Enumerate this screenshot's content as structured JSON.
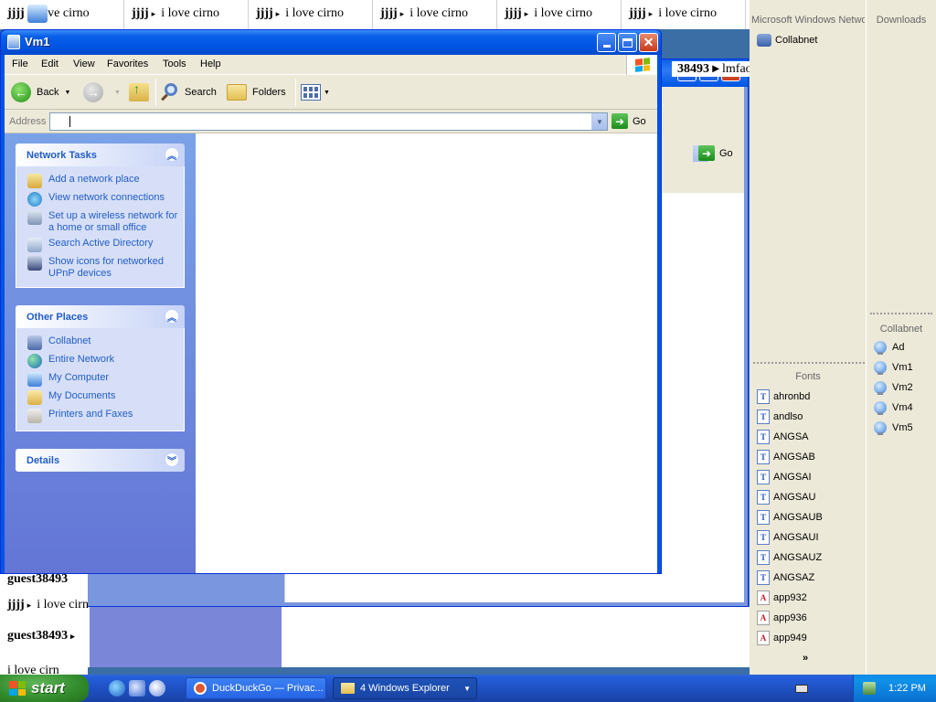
{
  "background_chat": {
    "tabs": [
      {
        "user": "jjjj",
        "text": "ve cirno"
      },
      {
        "user": "jjjj",
        "text": "i love cirno"
      },
      {
        "user": "jjjj",
        "text": "i love cirno"
      },
      {
        "user": "jjjj",
        "text": "i love cirno"
      },
      {
        "user": "jjjj",
        "text": "i love cirno"
      },
      {
        "user": "jjjj",
        "text": "i love cirno"
      }
    ],
    "side_user": "38493",
    "side_text": "lmfao",
    "left_rows": [
      {
        "user": "guest38493",
        "text": ""
      },
      {
        "user": "jjjj",
        "text": "i love cirn"
      },
      {
        "user": "guest38493",
        "text": ""
      },
      {
        "user": "",
        "text": "i love cirn"
      }
    ]
  },
  "right_panel": {
    "network_header": "Microsoft Windows Network",
    "network_items": [
      "Collabnet"
    ],
    "downloads_header": "Downloads",
    "collabnet_header": "Collabnet",
    "collabnet_items": [
      "Ad",
      "Vm1",
      "Vm2",
      "Vm4",
      "Vm5"
    ],
    "fonts_header": "Fonts",
    "fonts_items": [
      {
        "name": "ahronbd",
        "type": "T"
      },
      {
        "name": "andlso",
        "type": "T"
      },
      {
        "name": "ANGSA",
        "type": "T"
      },
      {
        "name": "ANGSAB",
        "type": "T"
      },
      {
        "name": "ANGSAI",
        "type": "T"
      },
      {
        "name": "ANGSAU",
        "type": "T"
      },
      {
        "name": "ANGSAUB",
        "type": "T"
      },
      {
        "name": "ANGSAUI",
        "type": "T"
      },
      {
        "name": "ANGSAUZ",
        "type": "T"
      },
      {
        "name": "ANGSAZ",
        "type": "T"
      },
      {
        "name": "app932",
        "type": "A"
      },
      {
        "name": "app936",
        "type": "A"
      },
      {
        "name": "app949",
        "type": "A"
      }
    ],
    "more": "»"
  },
  "window": {
    "title": "Vm1",
    "menu": [
      "File",
      "Edit",
      "View",
      "Favorites",
      "Tools",
      "Help"
    ],
    "toolbar": {
      "back": "Back",
      "search": "Search",
      "folders": "Folders"
    },
    "address": {
      "label": "Address",
      "value": "",
      "go": "Go"
    },
    "network_tasks": {
      "title": "Network Tasks",
      "items": [
        "Add a network place",
        "View network connections",
        "Set up a wireless network for a home or small office",
        "Search Active Directory",
        "Show icons for networked UPnP devices"
      ]
    },
    "other_places": {
      "title": "Other Places",
      "items": [
        "Collabnet",
        "Entire Network",
        "My Computer",
        "My Documents",
        "Printers and Faxes"
      ]
    },
    "details": {
      "title": "Details"
    }
  },
  "back_window": {
    "go": "Go"
  },
  "taskbar": {
    "start": "start",
    "buttons": [
      {
        "label": "DuckDuckGo — Privac..."
      },
      {
        "label": "4 Windows Explorer"
      }
    ],
    "clock": "1:22 PM"
  },
  "colors": {
    "xp_blue": "#0054e3",
    "task_link": "#215dc6",
    "start_green": "#318a2b"
  }
}
